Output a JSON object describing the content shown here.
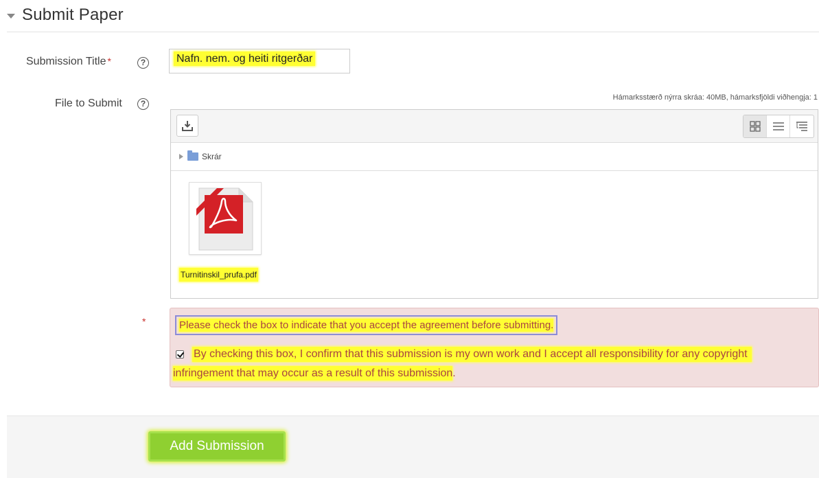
{
  "section": {
    "title": "Submit Paper"
  },
  "form": {
    "title_label": "Submission Title",
    "title_required_marker": "*",
    "help_glyph": "?",
    "title_value": "Nafn. nem. og heiti ritgerðar",
    "file_label": "File to Submit"
  },
  "filemanager": {
    "limits": "Hámarksstærð nýrra skráa: 40MB, hámarksfjöldi viðhengja: 1",
    "path_folder": "Skrár",
    "file_name": "Turnitinskil_prufa.pdf",
    "add_icon": "download-icon",
    "view_icons": [
      "grid-icon",
      "list-icon",
      "tree-icon"
    ]
  },
  "agreement": {
    "required_marker": "*",
    "warning": "Please check the box to indicate that you accept the agreement before submitting.",
    "checked": true,
    "text_line1": "By checking this box, I confirm that this submission is my own work and I accept all responsibility for any copyright",
    "text_line2": "infringement that may occur as a result of this submission",
    "text_end": "."
  },
  "footer": {
    "submit_label": "Add Submission"
  },
  "colors": {
    "highlight": "#ffff33",
    "error_bg": "#f2dede",
    "error_text": "#a94442",
    "submit_bg": "#8fd031",
    "pdf_red": "#d42127"
  }
}
